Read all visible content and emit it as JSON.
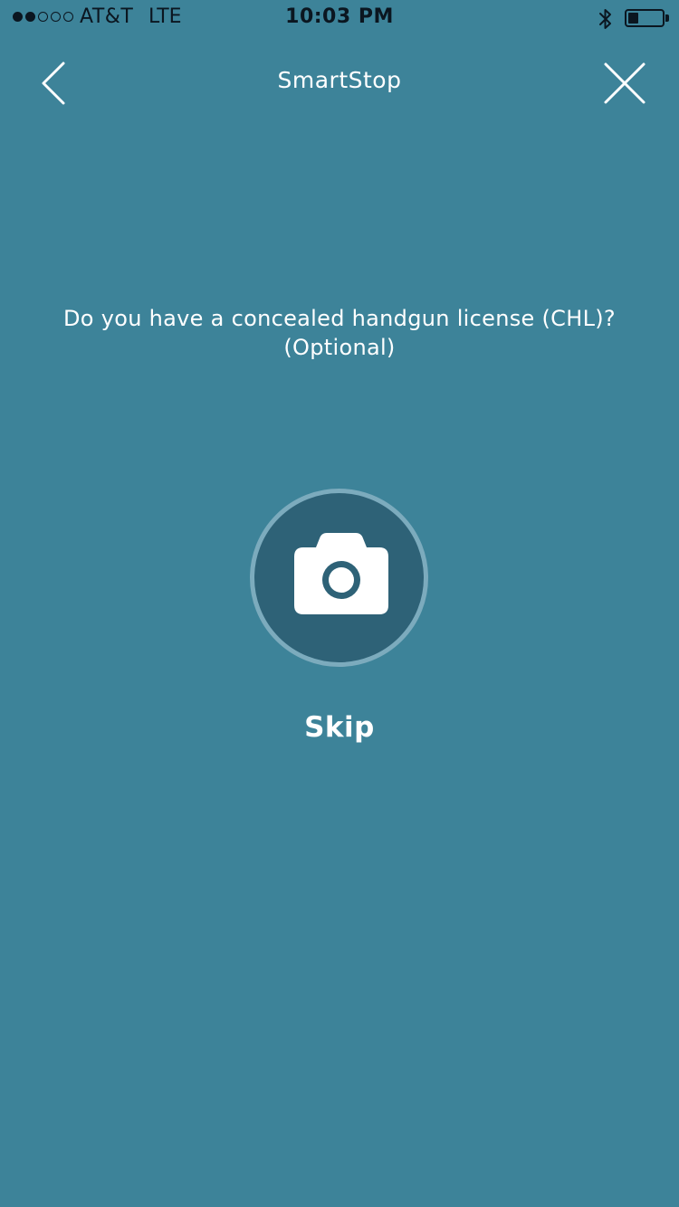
{
  "status_bar": {
    "signal_bars_filled": 2,
    "signal_bars_total": 5,
    "carrier": "AT&T",
    "network": "LTE",
    "time": "10:03 PM",
    "bluetooth_icon": "bluetooth-icon",
    "battery_level": 0.3
  },
  "nav": {
    "back_icon": "chevron-left-icon",
    "title": "SmartStop",
    "close_icon": "close-icon"
  },
  "main": {
    "question_line1": "Do you have a concealed handgun license (CHL)?",
    "question_line2": "(Optional)",
    "camera_icon": "camera-icon",
    "skip_label": "Skip"
  },
  "colors": {
    "background": "#3d8399",
    "camera_circle": "#2e6277",
    "camera_ring": "#7cabbd",
    "status_text": "#0b1620",
    "foreground": "#ffffff"
  }
}
